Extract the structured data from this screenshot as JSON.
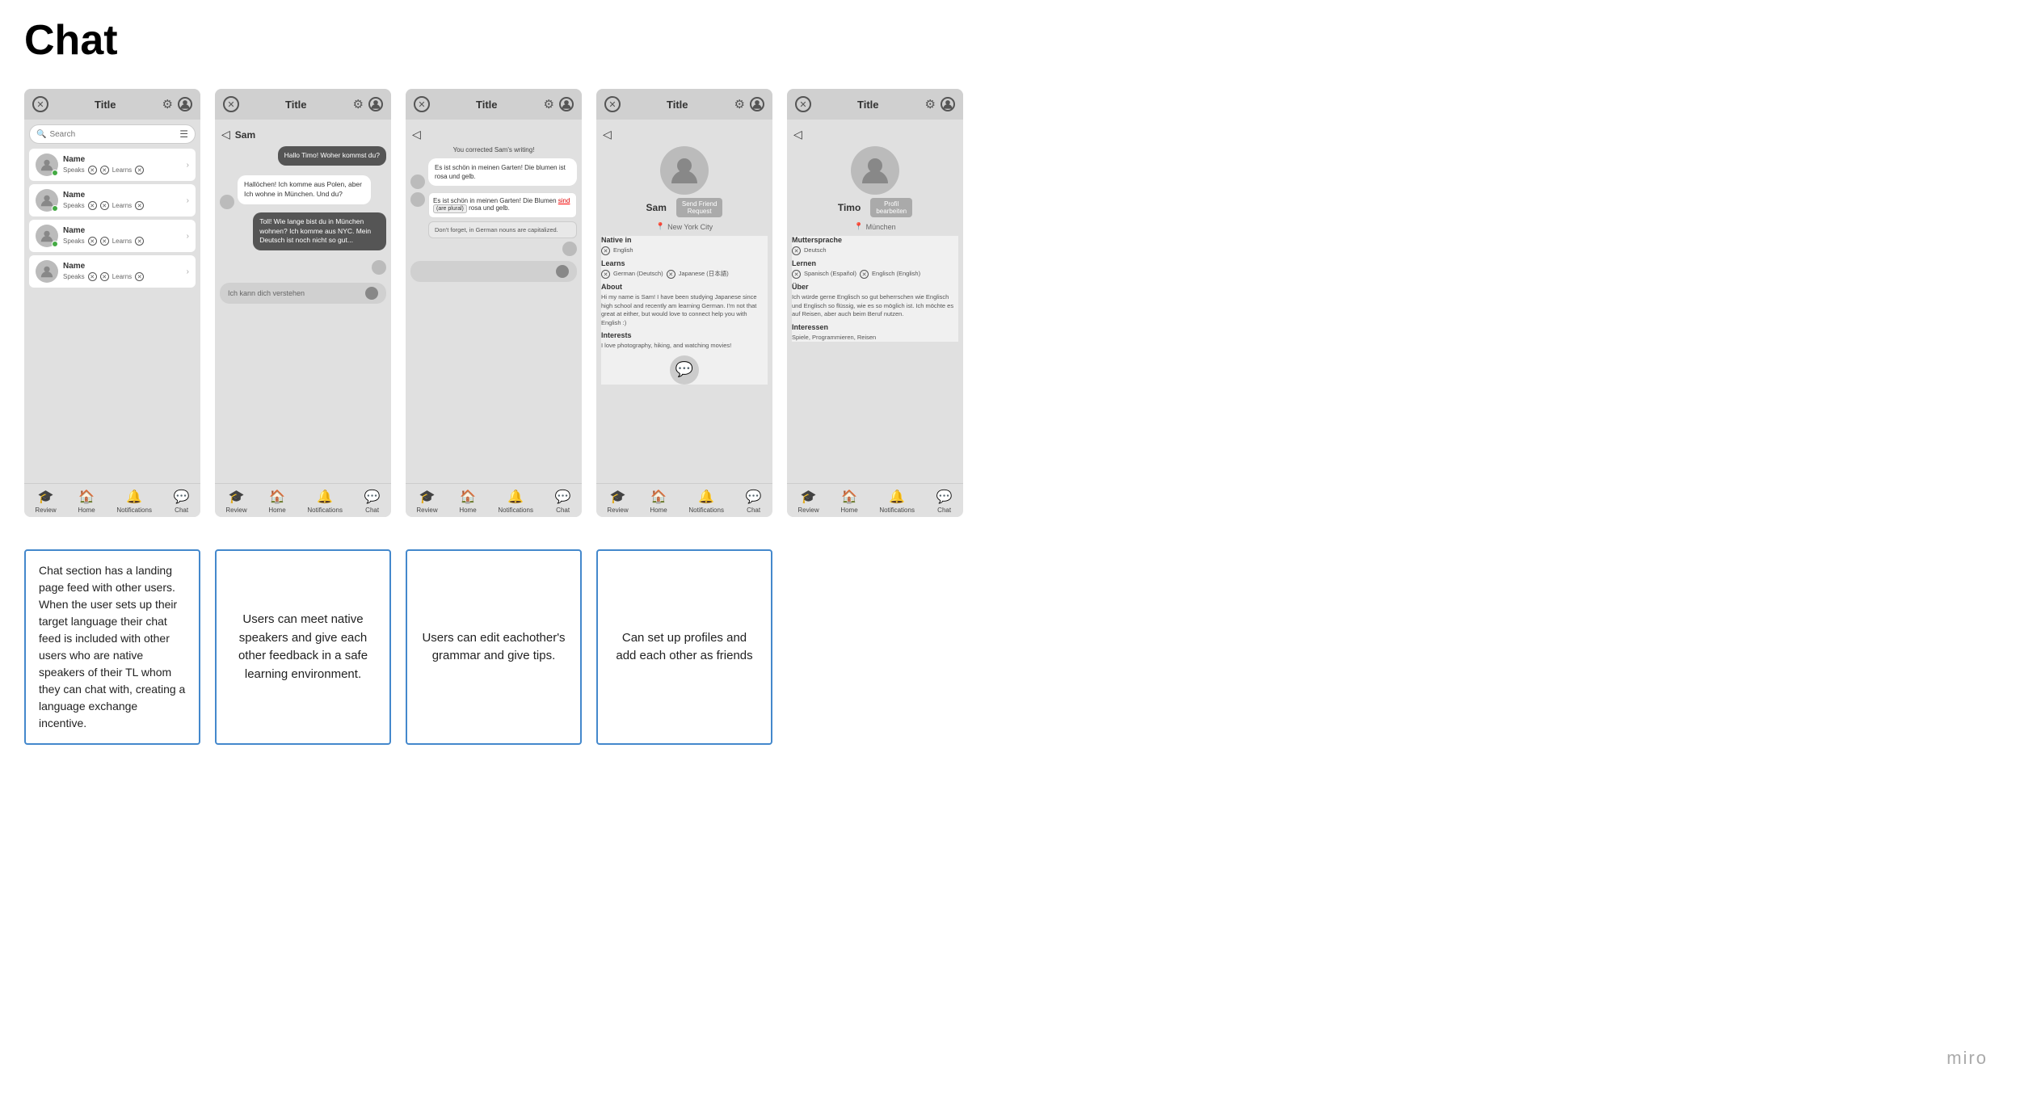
{
  "page": {
    "title": "Chat",
    "miro": "miro"
  },
  "screens": [
    {
      "id": "screen1",
      "topbar": {
        "title": "Title",
        "has_back": false
      },
      "type": "chat_list",
      "search_placeholder": "Search",
      "users": [
        {
          "name": "Name",
          "speaks": "Speaks",
          "learns": "Learns",
          "online": true
        },
        {
          "name": "Name",
          "speaks": "Speaks",
          "learns": "Learns",
          "online": true
        },
        {
          "name": "Name",
          "speaks": "Speaks",
          "learns": "Learns",
          "online": true
        },
        {
          "name": "Name",
          "speaks": "Speaks",
          "learns": "Learns",
          "online": false
        }
      ],
      "nav": [
        "Review",
        "Home",
        "Notifications",
        "Chat"
      ]
    },
    {
      "id": "screen2",
      "topbar": {
        "title": "Title",
        "has_back": false
      },
      "type": "chat_convo",
      "back_name": "Sam",
      "messages": [
        {
          "type": "sent",
          "text": "Hallo Timo! Woher kommst du?"
        },
        {
          "type": "received",
          "text": "Hallöchen! Ich komme aus Polen, aber Ich wohne in München. Und du?"
        },
        {
          "type": "sent",
          "text": "Toll! Wie lange bist du in München wohnen? Ich komme aus NYC. Mein Deutsch ist noch nicht so gut..."
        }
      ],
      "input_text": "Ich kann dich verstehen",
      "nav": [
        "Review",
        "Home",
        "Notifications",
        "Chat"
      ]
    },
    {
      "id": "screen3",
      "topbar": {
        "title": "Title",
        "has_back": false
      },
      "type": "grammar",
      "system_msg": "You corrected Sam's writing!",
      "original_msg": "Es ist schön in meinen Garten! Die blumen ist rosa und gelb.",
      "correction_text": "Es ist schön in meinen Garten! Die Blumen sind (are plural) rosa und gelb.",
      "tip_text": "Don't forget, in German nouns are capitalized.",
      "nav": [
        "Review",
        "Home",
        "Notifications",
        "Chat"
      ]
    },
    {
      "id": "screen4",
      "topbar": {
        "title": "Title",
        "has_back": false
      },
      "type": "profile_sam",
      "name": "Sam",
      "location": "New York City",
      "btn_label": "Send Friend Request",
      "native_in": "Native in",
      "native_lang": "English",
      "learns_label": "Learns",
      "learns_langs": [
        "German (Deutsch)",
        "Japanese (日本語)"
      ],
      "about_label": "About",
      "about_text": "Hi my name is Sam! I have been studying Japanese since high school and recently am learning German. I'm not that great at either, but would love to connect help you with English :)",
      "interests_label": "Interests",
      "interests_text": "I love photography, hiking, and watching movies!",
      "nav": [
        "Review",
        "Home",
        "Notifications",
        "Chat"
      ]
    },
    {
      "id": "screen5",
      "topbar": {
        "title": "Title",
        "has_back": false
      },
      "type": "profile_timo",
      "name": "Timo",
      "location": "München",
      "btn_label": "Profil bearbeiten",
      "muttersprache": "Muttersprache",
      "native_lang": "Deutsch",
      "lernen": "Lernen",
      "learns_langs": [
        "Spanisch (Español)",
        "Englisch (English)"
      ],
      "ueber": "Über",
      "ueber_text": "Ich würde gerne Englisch so gut beherrschen wie Englisch und Englisch so flüssig, wie es so möglich ist. Ich möchte es auf Reisen, aber auch beim Beruf nutzen.",
      "interessen": "Interessen",
      "interessen_text": "Spiele, Programmieren, Reisen",
      "nav": [
        "Review",
        "Home",
        "Notifications",
        "Chat"
      ]
    }
  ],
  "descriptions": [
    {
      "text": "Chat section has a landing page feed with other users. When the user sets up their target language their chat feed is included with other users who are native speakers of their TL whom they can chat with, creating a language exchange incentive."
    },
    {
      "text": "Users can meet native speakers and give each other feedback in a safe learning environment."
    },
    {
      "text": "Users can edit eachother's grammar and give tips."
    },
    {
      "text": "Can set up profiles and add each other as friends"
    }
  ],
  "nav_labels": {
    "review": "Review",
    "home": "Home",
    "notifications": "Notifications",
    "chat": "Chat"
  }
}
